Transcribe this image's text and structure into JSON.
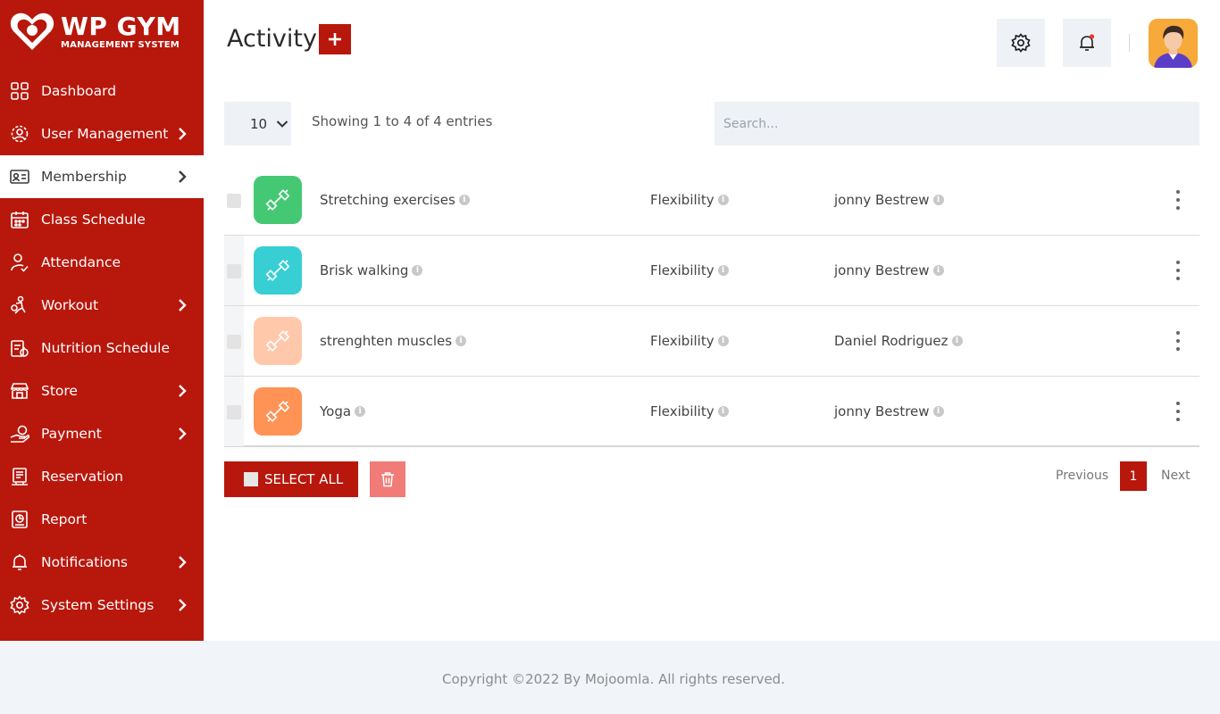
{
  "brand": {
    "title": "WP GYM",
    "subtitle": "MANAGEMENT SYSTEM",
    "primary_color": "#b8170c"
  },
  "sidebar": {
    "items": [
      {
        "label": "Dashboard",
        "icon": "dashboard-icon",
        "has_submenu": false,
        "active": false
      },
      {
        "label": "User Management",
        "icon": "users-gear-icon",
        "has_submenu": true,
        "active": false
      },
      {
        "label": "Membership",
        "icon": "membership-card-icon",
        "has_submenu": true,
        "active": true
      },
      {
        "label": "Class Schedule",
        "icon": "calendar-icon",
        "has_submenu": false,
        "active": false
      },
      {
        "label": "Attendance",
        "icon": "attendance-icon",
        "has_submenu": false,
        "active": false
      },
      {
        "label": "Workout",
        "icon": "workout-icon",
        "has_submenu": true,
        "active": false
      },
      {
        "label": "Nutrition Schedule",
        "icon": "nutrition-icon",
        "has_submenu": false,
        "active": false
      },
      {
        "label": "Store",
        "icon": "store-icon",
        "has_submenu": true,
        "active": false
      },
      {
        "label": "Payment",
        "icon": "payment-icon",
        "has_submenu": true,
        "active": false
      },
      {
        "label": "Reservation",
        "icon": "reservation-icon",
        "has_submenu": false,
        "active": false
      },
      {
        "label": "Report",
        "icon": "report-icon",
        "has_submenu": false,
        "active": false
      },
      {
        "label": "Notifications",
        "icon": "bell-icon",
        "has_submenu": true,
        "active": false
      },
      {
        "label": "System Settings",
        "icon": "gear-icon",
        "has_submenu": true,
        "active": false
      }
    ]
  },
  "header": {
    "title": "Activity",
    "add_icon": "plus-icon",
    "settings_icon": "gear-icon",
    "notification_icon": "bell-icon",
    "avatar": "user-avatar"
  },
  "table_controls": {
    "page_length": "10",
    "info": "Showing 1 to 4 of 4 entries",
    "search_placeholder": "Search..."
  },
  "activities": [
    {
      "name": "Stretching exercises",
      "category": "Flexibility",
      "user": "jonny Bestrew",
      "icon_color": "#45c873"
    },
    {
      "name": "Brisk walking",
      "category": "Flexibility",
      "user": "jonny Bestrew",
      "icon_color": "#37cfd3"
    },
    {
      "name": "strenghten muscles",
      "category": "Flexibility",
      "user": "Daniel Rodriguez",
      "icon_color": "#ffc8aa"
    },
    {
      "name": "Yoga",
      "category": "Flexibility",
      "user": "jonny Bestrew",
      "icon_color": "#ff9255"
    }
  ],
  "bulk": {
    "select_all_label": "SELECT ALL",
    "delete_icon": "trash-icon"
  },
  "pagination": {
    "previous": "Previous",
    "current": "1",
    "next": "Next"
  },
  "footer": {
    "copyright": "Copyright ©2022 By Mojoomla. All rights reserved."
  }
}
